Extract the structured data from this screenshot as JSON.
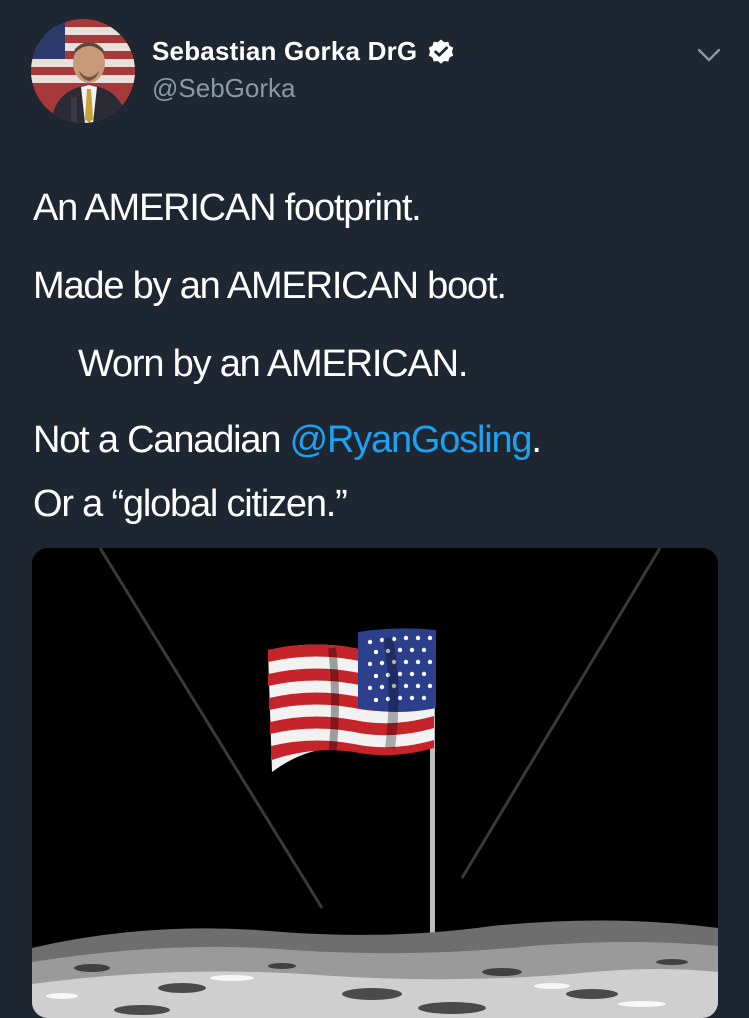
{
  "user": {
    "display_name": "Sebastian Gorka DrG",
    "handle": "@SebGorka",
    "verified": true
  },
  "tweet": {
    "line1": "An AMERICAN footprint.",
    "line2": "Made by an AMERICAN boot.",
    "line3": "Worn by an AMERICAN.",
    "line4_prefix": "Not a Canadian ",
    "line4_mention": "@RyanGosling",
    "line4_suffix": ".",
    "line5": "Or a “global citizen.”"
  },
  "colors": {
    "background": "#1e2632",
    "text": "#ffffff",
    "secondary_text": "#8899a6",
    "link": "#1da1f2"
  },
  "icons": {
    "verified": "verified-badge-icon",
    "caret": "chevron-down-icon"
  }
}
